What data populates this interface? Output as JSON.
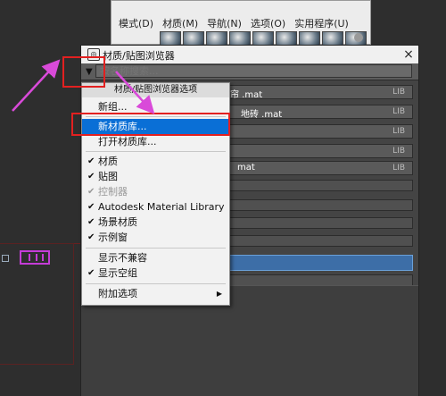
{
  "slate_editor": {
    "menu": [
      "模式(D)",
      "材质(M)",
      "导航(N)",
      "选项(O)",
      "实用程序(U)"
    ]
  },
  "browser": {
    "title": "材质/贴图浏览器",
    "search_placeholder": "按名称搜索...",
    "libraries": [
      {
        "name": "窗帘 .mat",
        "tag": "LIB"
      },
      {
        "name": "地砖 .mat",
        "tag": "LIB"
      },
      {
        "name": "",
        "tag": "LIB"
      },
      {
        "name": "",
        "tag": "LIB"
      },
      {
        "name": "mat",
        "tag": "LIB"
      }
    ]
  },
  "context_menu": {
    "header": "材质/贴图浏览器选项",
    "items": [
      {
        "label": "新组...",
        "checked": false,
        "disabled": false
      },
      {
        "label": "新材质库...",
        "checked": false,
        "disabled": false,
        "highlighted": true
      },
      {
        "label": "打开材质库...",
        "checked": false,
        "disabled": false
      },
      {
        "label": "材质",
        "checked": true,
        "disabled": false
      },
      {
        "label": "贴图",
        "checked": true,
        "disabled": false
      },
      {
        "label": "控制器",
        "checked": true,
        "disabled": true
      },
      {
        "label": "Autodesk Material Library",
        "checked": true,
        "disabled": false
      },
      {
        "label": "场景材质",
        "checked": true,
        "disabled": false
      },
      {
        "label": "示例窗",
        "checked": true,
        "disabled": false
      },
      {
        "label": "显示不兼容",
        "checked": false,
        "disabled": false
      },
      {
        "label": "显示空组",
        "checked": true,
        "disabled": false
      },
      {
        "label": "附加选项",
        "checked": false,
        "disabled": false,
        "submenu": true
      }
    ],
    "check_glyph": "✔",
    "submenu_glyph": "▶"
  },
  "icons": {
    "close": "×",
    "search_expand": "▼"
  },
  "colors": {
    "highlight": "#0a6fd6",
    "annotation_red": "#e32020",
    "annotation_arrow": "#d94ad9",
    "selection_blue": "#3d6ea7"
  }
}
